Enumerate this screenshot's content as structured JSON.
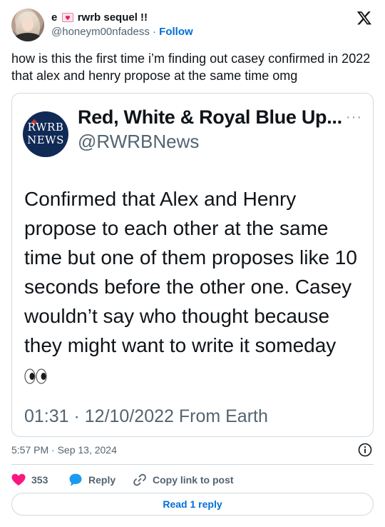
{
  "author": {
    "display_name_prefix": "e",
    "display_name_suffix": "rwrb sequel !!",
    "badge_icon": "heart-letter-icon",
    "handle": "@honeym00nfadess",
    "separator": "·",
    "follow_label": "Follow"
  },
  "tweet": {
    "text": "how is this the first time i’m finding out casey confirmed in 2022 that alex and henry propose at the same time omg",
    "timestamp": "5:57 PM · Sep 13, 2024"
  },
  "quoted": {
    "avatar_line1": "RWRB",
    "avatar_line2": "NEWS",
    "name": "Red, White & Royal Blue Up...",
    "handle": "@RWRBNews",
    "more_glyph": "···",
    "body": "Confirmed that Alex and Henry propose to each other at the same time but one of them proposes like 10 seconds before the other one. Casey wouldn’t say who thought because they might want to write it someday",
    "body_emoji": "eyes-emoji",
    "meta": "01:31 · 12/10/2022 From Earth"
  },
  "actions": {
    "like_count": "353",
    "reply_label": "Reply",
    "copy_label": "Copy link to post"
  },
  "read_reply_label": "Read 1 reply",
  "colors": {
    "accent": "#006fd6",
    "like": "#f91880",
    "reply_icon": "#1d9bf0",
    "muted": "#536471",
    "border": "#cfd9de",
    "rwrb_avatar": "#102a56"
  }
}
